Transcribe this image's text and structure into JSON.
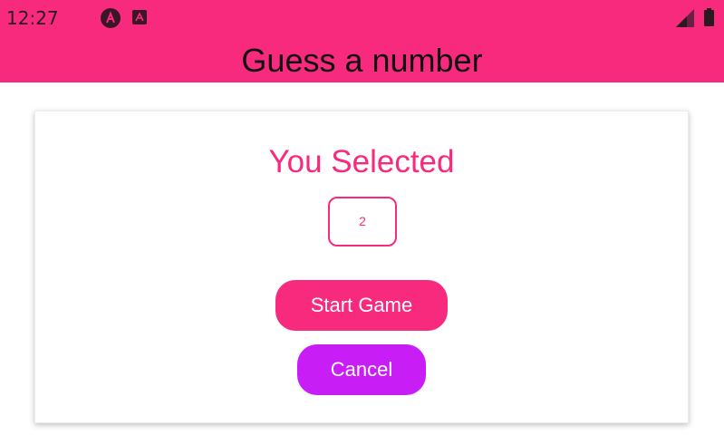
{
  "status_bar": {
    "time": "12:27",
    "icons": [
      "app-notification-icon",
      "a-box-notification-icon",
      "signal-icon",
      "battery-icon"
    ]
  },
  "app_bar": {
    "title": "Guess a number"
  },
  "card": {
    "title": "You Selected",
    "selected_number": "2",
    "start_button_label": "Start Game",
    "cancel_button_label": "Cancel"
  },
  "colors": {
    "primary": "#f72a7d",
    "accent": "#c81df4",
    "title_text": "#111111"
  }
}
